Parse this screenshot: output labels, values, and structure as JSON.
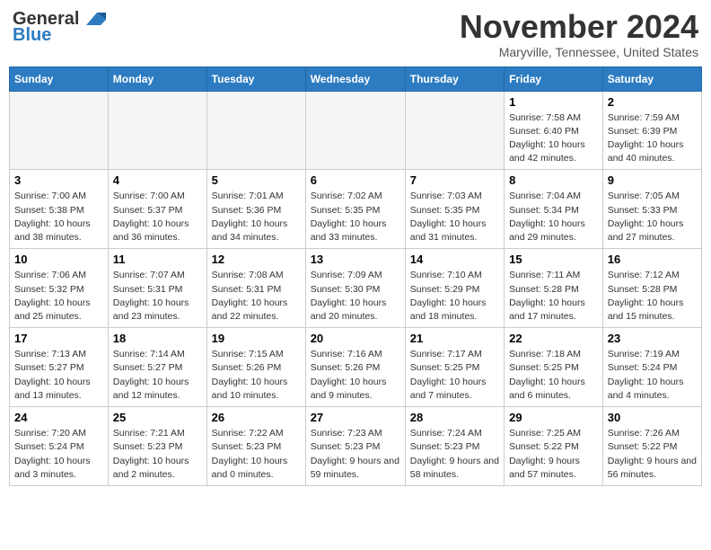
{
  "header": {
    "logo_line1": "General",
    "logo_line2": "Blue",
    "month": "November 2024",
    "location": "Maryville, Tennessee, United States"
  },
  "days_of_week": [
    "Sunday",
    "Monday",
    "Tuesday",
    "Wednesday",
    "Thursday",
    "Friday",
    "Saturday"
  ],
  "weeks": [
    [
      {
        "day": "",
        "empty": true
      },
      {
        "day": "",
        "empty": true
      },
      {
        "day": "",
        "empty": true
      },
      {
        "day": "",
        "empty": true
      },
      {
        "day": "",
        "empty": true
      },
      {
        "day": "1",
        "info": "Sunrise: 7:58 AM\nSunset: 6:40 PM\nDaylight: 10 hours and 42 minutes."
      },
      {
        "day": "2",
        "info": "Sunrise: 7:59 AM\nSunset: 6:39 PM\nDaylight: 10 hours and 40 minutes."
      }
    ],
    [
      {
        "day": "3",
        "info": "Sunrise: 7:00 AM\nSunset: 5:38 PM\nDaylight: 10 hours and 38 minutes."
      },
      {
        "day": "4",
        "info": "Sunrise: 7:00 AM\nSunset: 5:37 PM\nDaylight: 10 hours and 36 minutes."
      },
      {
        "day": "5",
        "info": "Sunrise: 7:01 AM\nSunset: 5:36 PM\nDaylight: 10 hours and 34 minutes."
      },
      {
        "day": "6",
        "info": "Sunrise: 7:02 AM\nSunset: 5:35 PM\nDaylight: 10 hours and 33 minutes."
      },
      {
        "day": "7",
        "info": "Sunrise: 7:03 AM\nSunset: 5:35 PM\nDaylight: 10 hours and 31 minutes."
      },
      {
        "day": "8",
        "info": "Sunrise: 7:04 AM\nSunset: 5:34 PM\nDaylight: 10 hours and 29 minutes."
      },
      {
        "day": "9",
        "info": "Sunrise: 7:05 AM\nSunset: 5:33 PM\nDaylight: 10 hours and 27 minutes."
      }
    ],
    [
      {
        "day": "10",
        "info": "Sunrise: 7:06 AM\nSunset: 5:32 PM\nDaylight: 10 hours and 25 minutes."
      },
      {
        "day": "11",
        "info": "Sunrise: 7:07 AM\nSunset: 5:31 PM\nDaylight: 10 hours and 23 minutes."
      },
      {
        "day": "12",
        "info": "Sunrise: 7:08 AM\nSunset: 5:31 PM\nDaylight: 10 hours and 22 minutes."
      },
      {
        "day": "13",
        "info": "Sunrise: 7:09 AM\nSunset: 5:30 PM\nDaylight: 10 hours and 20 minutes."
      },
      {
        "day": "14",
        "info": "Sunrise: 7:10 AM\nSunset: 5:29 PM\nDaylight: 10 hours and 18 minutes."
      },
      {
        "day": "15",
        "info": "Sunrise: 7:11 AM\nSunset: 5:28 PM\nDaylight: 10 hours and 17 minutes."
      },
      {
        "day": "16",
        "info": "Sunrise: 7:12 AM\nSunset: 5:28 PM\nDaylight: 10 hours and 15 minutes."
      }
    ],
    [
      {
        "day": "17",
        "info": "Sunrise: 7:13 AM\nSunset: 5:27 PM\nDaylight: 10 hours and 13 minutes."
      },
      {
        "day": "18",
        "info": "Sunrise: 7:14 AM\nSunset: 5:27 PM\nDaylight: 10 hours and 12 minutes."
      },
      {
        "day": "19",
        "info": "Sunrise: 7:15 AM\nSunset: 5:26 PM\nDaylight: 10 hours and 10 minutes."
      },
      {
        "day": "20",
        "info": "Sunrise: 7:16 AM\nSunset: 5:26 PM\nDaylight: 10 hours and 9 minutes."
      },
      {
        "day": "21",
        "info": "Sunrise: 7:17 AM\nSunset: 5:25 PM\nDaylight: 10 hours and 7 minutes."
      },
      {
        "day": "22",
        "info": "Sunrise: 7:18 AM\nSunset: 5:25 PM\nDaylight: 10 hours and 6 minutes."
      },
      {
        "day": "23",
        "info": "Sunrise: 7:19 AM\nSunset: 5:24 PM\nDaylight: 10 hours and 4 minutes."
      }
    ],
    [
      {
        "day": "24",
        "info": "Sunrise: 7:20 AM\nSunset: 5:24 PM\nDaylight: 10 hours and 3 minutes."
      },
      {
        "day": "25",
        "info": "Sunrise: 7:21 AM\nSunset: 5:23 PM\nDaylight: 10 hours and 2 minutes."
      },
      {
        "day": "26",
        "info": "Sunrise: 7:22 AM\nSunset: 5:23 PM\nDaylight: 10 hours and 0 minutes."
      },
      {
        "day": "27",
        "info": "Sunrise: 7:23 AM\nSunset: 5:23 PM\nDaylight: 9 hours and 59 minutes."
      },
      {
        "day": "28",
        "info": "Sunrise: 7:24 AM\nSunset: 5:23 PM\nDaylight: 9 hours and 58 minutes."
      },
      {
        "day": "29",
        "info": "Sunrise: 7:25 AM\nSunset: 5:22 PM\nDaylight: 9 hours and 57 minutes."
      },
      {
        "day": "30",
        "info": "Sunrise: 7:26 AM\nSunset: 5:22 PM\nDaylight: 9 hours and 56 minutes."
      }
    ]
  ]
}
